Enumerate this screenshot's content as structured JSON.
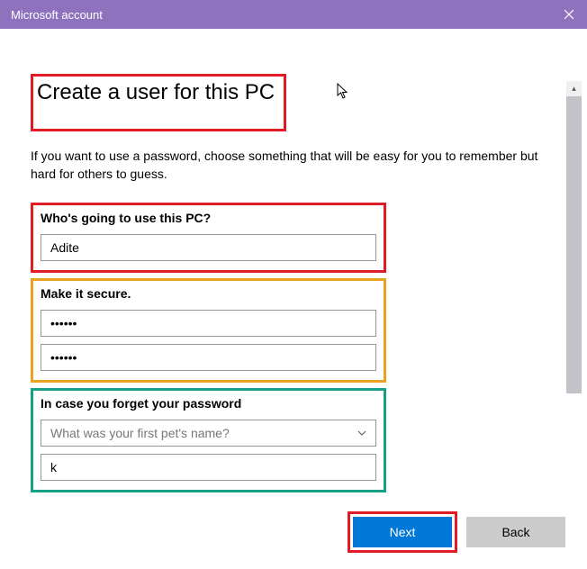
{
  "titlebar": {
    "title": "Microsoft account"
  },
  "page": {
    "heading": "Create a user for this PC",
    "subtext": "If you want to use a password, choose something that will be easy for you to remember but hard for others to guess."
  },
  "section_user": {
    "label": "Who's going to use this PC?",
    "username_value": "Adite"
  },
  "section_secure": {
    "label": "Make it secure.",
    "password_value": "••••••",
    "confirm_value": "••••••"
  },
  "section_recovery": {
    "label": "In case you forget your password",
    "question_placeholder": "What was your first pet's name?",
    "answer_value": "k"
  },
  "footer": {
    "next_label": "Next",
    "back_label": "Back"
  }
}
